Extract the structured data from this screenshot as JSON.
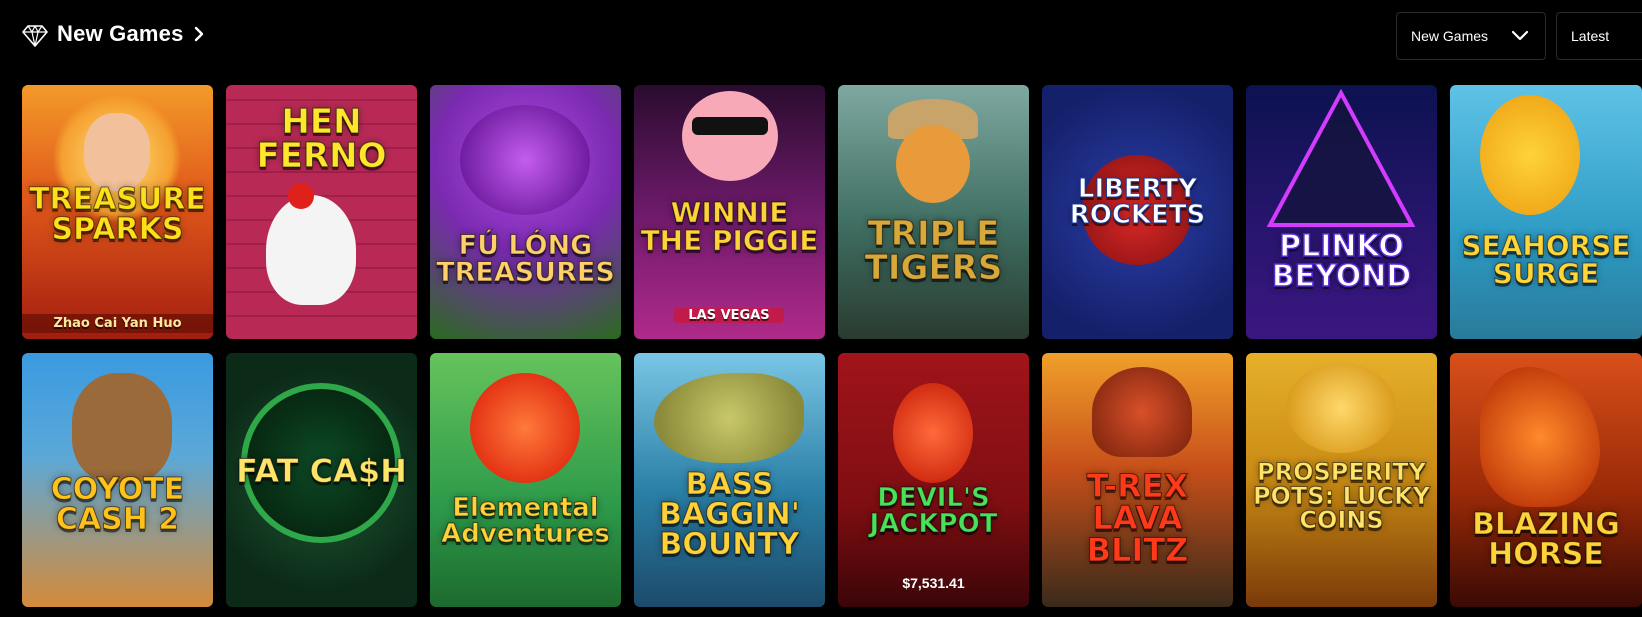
{
  "header": {
    "title": "New Games",
    "title_icon": "diamond-icon",
    "category_select": "New Games",
    "sort_select": "Latest"
  },
  "games_row1": [
    {
      "title": "TREASURE SPARKS",
      "subtitle": "Zhao Cai Yan Huo",
      "color": "#e0581a"
    },
    {
      "title": "HEN FERNO",
      "subtitle": "",
      "color": "#c9325a"
    },
    {
      "title": "FÚ LÓNG TREASURES",
      "subtitle": "",
      "color": "#7a2ab0"
    },
    {
      "title": "WINNIE the Piggie",
      "subtitle": "LAS VEGAS",
      "color": "#9d2a8c"
    },
    {
      "title": "TRIPLE TIGERS",
      "subtitle": "",
      "color": "#4d7a72"
    },
    {
      "title": "LIBERTY ROCKETS",
      "subtitle": "",
      "color": "#1c2c8a"
    },
    {
      "title": "PLINKO BEYOND",
      "subtitle": "",
      "color": "#2a1570"
    },
    {
      "title": "SEAHORSE Surge",
      "subtitle": "",
      "color": "#2d9bc4"
    }
  ],
  "games_row2": [
    {
      "title": "COYOTE CASH 2",
      "subtitle": "",
      "color": "#2c7fc4",
      "jackpot": ""
    },
    {
      "title": "FAT CA$H",
      "subtitle": "",
      "color": "#0c3a22",
      "jackpot": ""
    },
    {
      "title": "Elemental Adventures",
      "subtitle": "",
      "color": "#2d9a4a",
      "jackpot": ""
    },
    {
      "title": "BASS BAGGIN' BOUNTY",
      "subtitle": "",
      "color": "#2a7fa6",
      "jackpot": ""
    },
    {
      "title": "DEVIL'S JACKPOT",
      "subtitle": "",
      "color": "#7e0e12",
      "jackpot": "$7,531.41"
    },
    {
      "title": "T-REX LAVA BLITZ",
      "subtitle": "",
      "color": "#b33a12",
      "jackpot": ""
    },
    {
      "title": "PROSPERITY POTS: LUCKY COINS",
      "subtitle": "",
      "color": "#c98a14",
      "jackpot": ""
    },
    {
      "title": "BLAZING HORSE",
      "subtitle": "",
      "color": "#9a2a08",
      "jackpot": ""
    }
  ]
}
